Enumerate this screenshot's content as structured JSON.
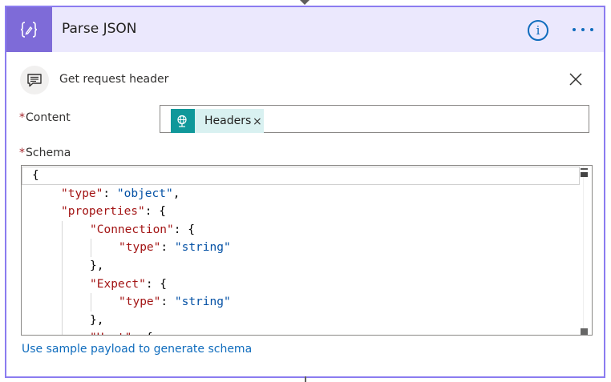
{
  "card": {
    "title": "Parse JSON",
    "info_label": "i",
    "more_label": "More options",
    "accent": "#7e6bd8",
    "border": "#8b7cf0"
  },
  "comment": {
    "text": "Get request header",
    "icon": "comment-icon",
    "close_icon": "close-icon"
  },
  "fields": {
    "required_marker": "*",
    "content_label": "Content",
    "schema_label": "Schema",
    "content_token": {
      "label": "Headers",
      "remove": "×",
      "icon": "globe-icon",
      "color": "#10989a"
    }
  },
  "schema_lines": [
    [
      "{"
    ],
    [
      "\"type\"",
      ": ",
      "\"object\"",
      ","
    ],
    [
      "\"properties\"",
      ": {"
    ],
    [
      "\"Connection\"",
      ": {"
    ],
    [
      "\"type\"",
      ": ",
      "\"string\""
    ],
    [
      "},"
    ],
    [
      "\"Expect\"",
      ": {"
    ],
    [
      "\"type\"",
      ": ",
      "\"string\""
    ],
    [
      "},"
    ],
    [
      "\"Host\"",
      ": {"
    ]
  ],
  "footer": {
    "link": "Use sample payload to generate schema"
  }
}
